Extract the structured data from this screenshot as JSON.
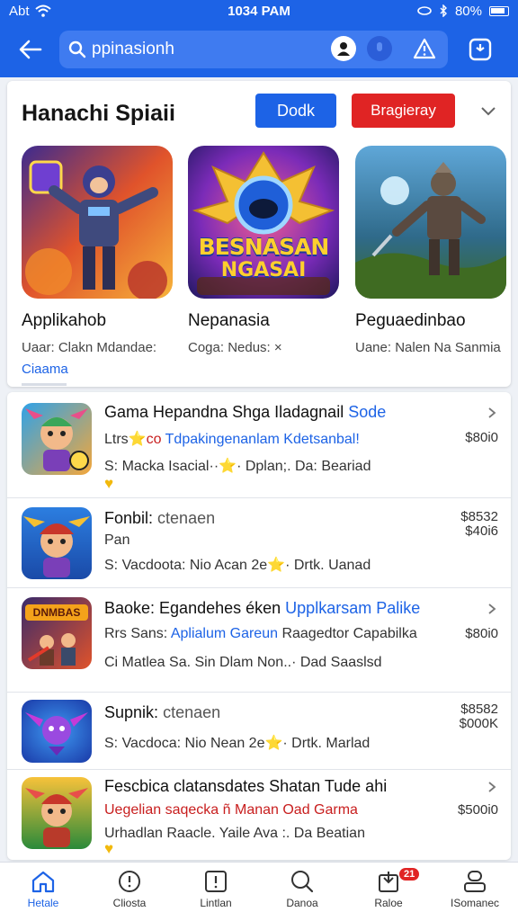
{
  "status_bar": {
    "carrier": "Abt",
    "time": "1034 PAM",
    "battery": "80%"
  },
  "search": {
    "value": "ppinasionh"
  },
  "featured": {
    "title": "Hanachi Spiaii",
    "button_primary": "Dodk",
    "button_danger": "Bragieray",
    "link": "Ciaama",
    "items": [
      {
        "name": "Applikahob",
        "subtitle": "Uaar: Clakn Mdandae:"
      },
      {
        "name": "Nepanasia",
        "subtitle": "Coga: Nedus: ×"
      },
      {
        "name": "Peguaedinbao",
        "subtitle": "Uane: Nalen Na Sanmia"
      }
    ],
    "banner_text_1": "BESNASAN",
    "banner_text_2": "NGASAI"
  },
  "list": [
    {
      "title": "Gama Hepandna Shga Iladagnail",
      "title_hl": "Sode",
      "line1_pre": "Ltrs",
      "line1_star": "⭐",
      "line1_red": "co",
      "line1_blue": "Tdpakingenanlam Kdetsanbal!",
      "line2": "S: Macka Isacial··⭐· Dplan;. Da: Beariad",
      "price": "$80i0",
      "heart": "♥"
    },
    {
      "title": "Fonbil:",
      "title_soft": "ctenaen",
      "line1": "Pan",
      "line2": "S: Vacdoota: Nio Acan 2e⭐· Drtk. Uanad",
      "price": "$8532",
      "price2": "$40i6"
    },
    {
      "title": "Baoke: Egandehes éken",
      "title_hl": "Upplkarsam Palike",
      "line1_pre": "Rrs Sans:",
      "line1_blue": "Aplialum Gareun",
      "line1_post": "Raagedtor Capabilka",
      "line2": "Ci Matlea Sa. Sin Dlam Non..· Dad Saaslsd",
      "price": "$80i0",
      "art_text": "DNMBAS"
    },
    {
      "title": "Supnik:",
      "title_soft": "ctenaen",
      "line2": "S: Vacdoca: Nio Nean 2e⭐· Drtk. Marlad",
      "price": "$8582",
      "price2": "$000K"
    },
    {
      "title": "Fescbica clatansdates Shatan Tude ahi",
      "line1_red": "Uegelian saqecka ñ Manan Oad Garma",
      "line2": "Urhadlan Raacle. Yaile Ava :. Da Beatian",
      "price": "$500i0",
      "heart": "♥"
    }
  ],
  "nav": [
    {
      "label": "Hetale",
      "icon": "home-icon",
      "active": true
    },
    {
      "label": "Cliosta",
      "icon": "alert-circle-icon"
    },
    {
      "label": "Lintlan",
      "icon": "warning-icon"
    },
    {
      "label": "Danoa",
      "icon": "search-icon"
    },
    {
      "label": "Raloe",
      "icon": "update-icon",
      "badge": "21"
    },
    {
      "label": "ISomanec",
      "icon": "profile-icon"
    }
  ],
  "colors": {
    "primary": "#1d63e6",
    "danger": "#e02424",
    "star": "#f2b90c"
  }
}
